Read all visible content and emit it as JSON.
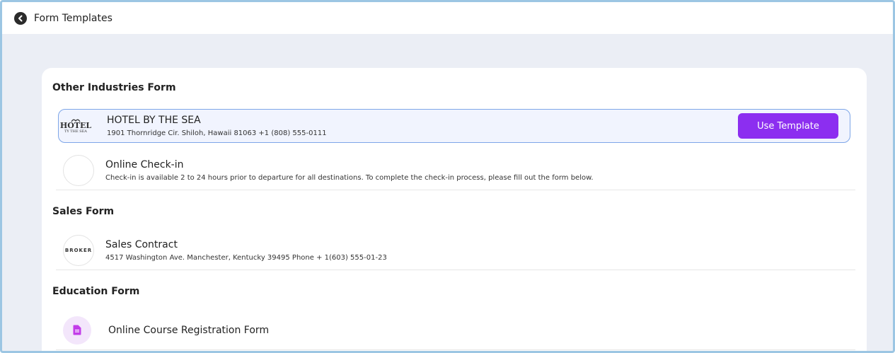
{
  "header": {
    "title": "Form Templates",
    "back_icon": "chevron-left-icon"
  },
  "sections": [
    {
      "title": "Other Industries Form",
      "items": [
        {
          "title": "HOTEL BY THE SEA",
          "subtitle": "1901 Thornridge Cir. Shiloh, Hawaii 81063 +1 (808) 555-0111",
          "logo": {
            "line1": "HOTEL",
            "line2": "TY THE SEA"
          },
          "selected": true,
          "action_label": "Use Template"
        },
        {
          "title": "Online Check-in",
          "subtitle": "Check-in is available 2 to 24 hours prior to departure for all destinations. To complete the check-in process, please fill out the form below."
        }
      ]
    },
    {
      "title": "Sales Form",
      "items": [
        {
          "title": "Sales Contract",
          "subtitle": "4517 Washington Ave. Manchester, Kentucky 39495 Phone + 1(603) 555-01-23",
          "logo": {
            "text": "BROKER"
          }
        }
      ]
    },
    {
      "title": "Education Form",
      "items": [
        {
          "title": "Online Course Registration Form",
          "icon": "document-icon"
        }
      ]
    }
  ],
  "colors": {
    "accent": "#8c2ef0",
    "selected_border": "#7ea6e8",
    "selected_bg": "#f1f4fe",
    "page_bg": "#ebeef5"
  }
}
